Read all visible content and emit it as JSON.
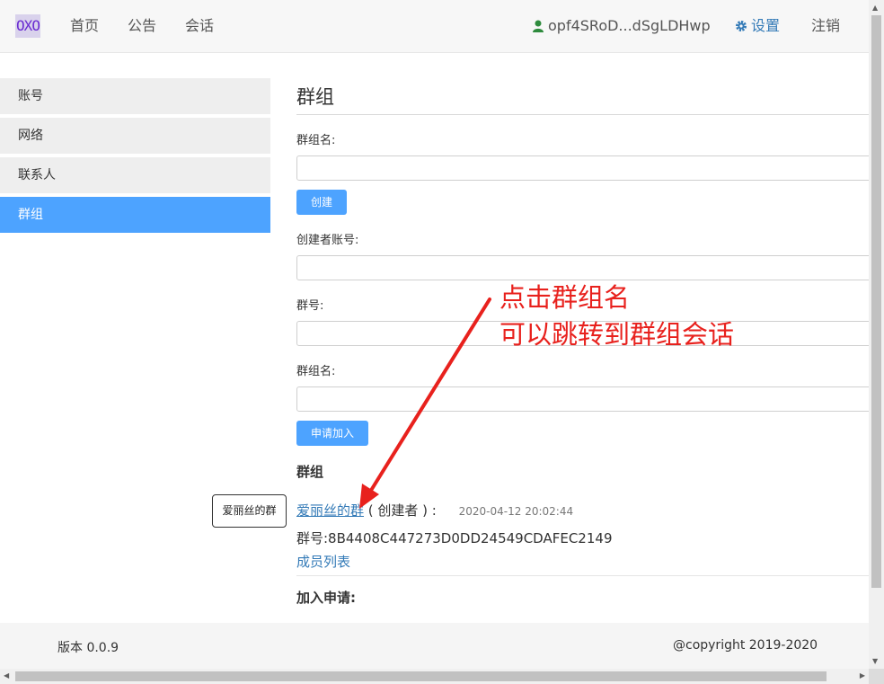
{
  "navbar": {
    "logo_text": "OXO",
    "home": "首页",
    "announcement": "公告",
    "chat": "会话",
    "user": "opf4SRoD...dSgLDHwp",
    "settings": "设置",
    "logout": "注销"
  },
  "sidebar": {
    "items": [
      {
        "label": "账号",
        "active": false
      },
      {
        "label": "网络",
        "active": false
      },
      {
        "label": "联系人",
        "active": false
      },
      {
        "label": "群组",
        "active": true
      }
    ]
  },
  "main": {
    "title": "群组",
    "create_form": {
      "name_label": "群组名:",
      "name_value": "",
      "create_button": "创建"
    },
    "join_form": {
      "creator_label": "创建者账号:",
      "creator_value": "",
      "group_id_label": "群号:",
      "group_id_value": "",
      "group_name_label": "群组名:",
      "group_name_value": "",
      "join_button": "申请加入"
    },
    "groups_section_title": "群组",
    "group": {
      "name": "爱丽丝的群",
      "creator_text": "( 创建者 ) :",
      "created_at": "2020-04-12 20:02:44",
      "group_id": "群号:8B4408C447273D0DD24549CDAFEC2149",
      "member_list_link": "成员列表"
    },
    "join_requests_title": "加入申请:",
    "tooltip": "爱丽丝的群"
  },
  "annotation": {
    "line1": "点击群组名",
    "line2": "可以跳转到群组会话",
    "color": "#e8211d"
  },
  "footer": {
    "version": "版本 0.0.9",
    "copyright": "@copyright 2019-2020"
  },
  "colors": {
    "accent": "#4da3ff",
    "link": "#337ab7"
  }
}
